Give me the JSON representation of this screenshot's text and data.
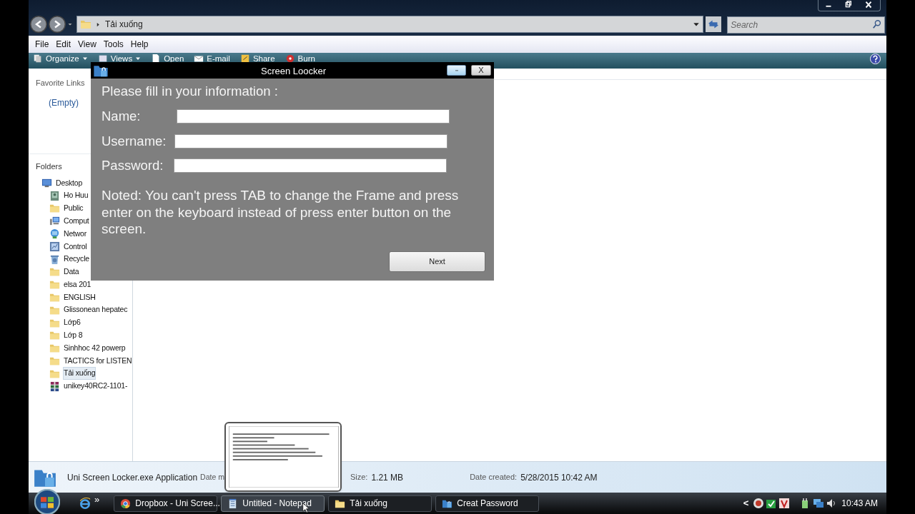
{
  "explorer": {
    "breadcrumb": "Tải xuống",
    "search": {
      "placeholder": "Search"
    },
    "menu": [
      "File",
      "Edit",
      "View",
      "Tools",
      "Help"
    ],
    "toolbar": [
      {
        "label": "Organize",
        "kind": "organize"
      },
      {
        "label": "Views",
        "kind": "views"
      },
      {
        "label": "Open",
        "kind": "open"
      },
      {
        "label": "E-mail",
        "kind": "email"
      },
      {
        "label": "Share",
        "kind": "share"
      },
      {
        "label": "Burn",
        "kind": "burn"
      }
    ],
    "favorite_links": {
      "title": "Favorite Links",
      "items": [
        "(Empty)"
      ]
    },
    "folders": {
      "title": "Folders",
      "tree": [
        {
          "label": "Desktop",
          "kind": "desktop",
          "selected": false,
          "children": [
            {
              "label": "Ho Huu",
              "kind": "user",
              "selected": false
            },
            {
              "label": "Public",
              "kind": "folder",
              "selected": false
            },
            {
              "label": "Comput",
              "kind": "computer",
              "selected": false
            },
            {
              "label": "Networ",
              "kind": "network",
              "selected": false
            },
            {
              "label": "Control",
              "kind": "control",
              "selected": false
            },
            {
              "label": "Recycle",
              "kind": "recycle",
              "selected": false
            },
            {
              "label": "Data",
              "kind": "folder",
              "selected": false
            },
            {
              "label": "elsa 201",
              "kind": "folder",
              "selected": false
            },
            {
              "label": "ENGLISH",
              "kind": "folder",
              "selected": false
            },
            {
              "label": "Glissonean hepatec",
              "kind": "folder",
              "selected": false
            },
            {
              "label": "Lớp6",
              "kind": "folder",
              "selected": false
            },
            {
              "label": "Lớp 8",
              "kind": "folder",
              "selected": false
            },
            {
              "label": "Sinhhoc 42 powerp",
              "kind": "folder",
              "selected": false
            },
            {
              "label": "TACTICS for LISTEN",
              "kind": "folder",
              "selected": false
            },
            {
              "label": "Tải xuống",
              "kind": "folder",
              "selected": true
            },
            {
              "label": "unikey40RC2-1101-",
              "kind": "archive",
              "selected": false
            }
          ]
        }
      ]
    },
    "details": {
      "name": "Uni Screen Locker.exe Application",
      "modified_label": "Date m",
      "size_label": "Size:",
      "size": "1.21 MB",
      "created_label": "Date created:",
      "created": "5/28/2015 10:42 AM"
    }
  },
  "dialog": {
    "title": "Screen Loocker",
    "close": "X",
    "heading": "Please fill in your information :",
    "fields": [
      {
        "label": "Name:"
      },
      {
        "label": "Username:"
      },
      {
        "label": "Password:"
      }
    ],
    "note": "Noted: You can't press TAB to change the Frame and press enter on the keyboard instead of press enter button on the screen.",
    "button": "Next"
  },
  "taskbar": {
    "overflow": "»",
    "items": [
      {
        "label": "Dropbox - Uni Scree...",
        "kind": "chrome",
        "selected": false
      },
      {
        "label": "Untitled - Notepad",
        "kind": "notepad",
        "selected": true
      },
      {
        "label": "Tải xuống",
        "kind": "folder",
        "selected": false
      },
      {
        "label": "Creat Password",
        "kind": "app",
        "selected": false
      }
    ],
    "tray_expand": "<",
    "clock": "10:43 AM"
  }
}
